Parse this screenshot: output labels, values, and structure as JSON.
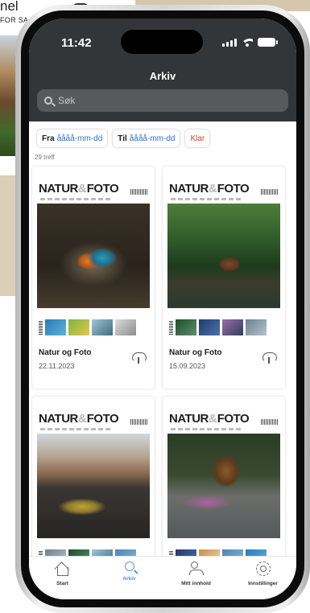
{
  "background": {
    "text_line1": "nel",
    "text_line2": "FOR SA"
  },
  "status_bar": {
    "time": "11:42"
  },
  "header": {
    "title": "Arkiv"
  },
  "search": {
    "placeholder": "Søk"
  },
  "filters": {
    "from_label": "Fra",
    "from_value": "åååå-mm-dd",
    "to_label": "Til",
    "to_value": "åååå-mm-dd",
    "clear_label": "Klar"
  },
  "results": {
    "count_text": "29 treff"
  },
  "issues": [
    {
      "masthead": "NATUR",
      "masthead_end": "FOTO",
      "amp": "&",
      "title": "Natur og Foto",
      "date": "22.11.2023"
    },
    {
      "masthead": "NATUR",
      "masthead_end": "FOTO",
      "amp": "&",
      "title": "Natur og Foto",
      "date": "15.09.2023"
    },
    {
      "masthead": "NATUR",
      "masthead_end": "FOTO",
      "amp": "&"
    },
    {
      "masthead": "NATUR",
      "masthead_end": "FOTO",
      "amp": "&"
    }
  ],
  "tabbar": {
    "items": [
      {
        "label": "Start",
        "icon": "home-icon"
      },
      {
        "label": "Arkiv",
        "icon": "search-icon",
        "active": true
      },
      {
        "label": "Mitt innhold",
        "icon": "person-icon"
      },
      {
        "label": "Innstillinger",
        "icon": "gear-icon"
      }
    ]
  },
  "colors": {
    "header_bg": "#333638",
    "accent_blue": "#2f6fd0",
    "clear_red": "#e43a2f",
    "tab_active": "#4f8fd6"
  }
}
